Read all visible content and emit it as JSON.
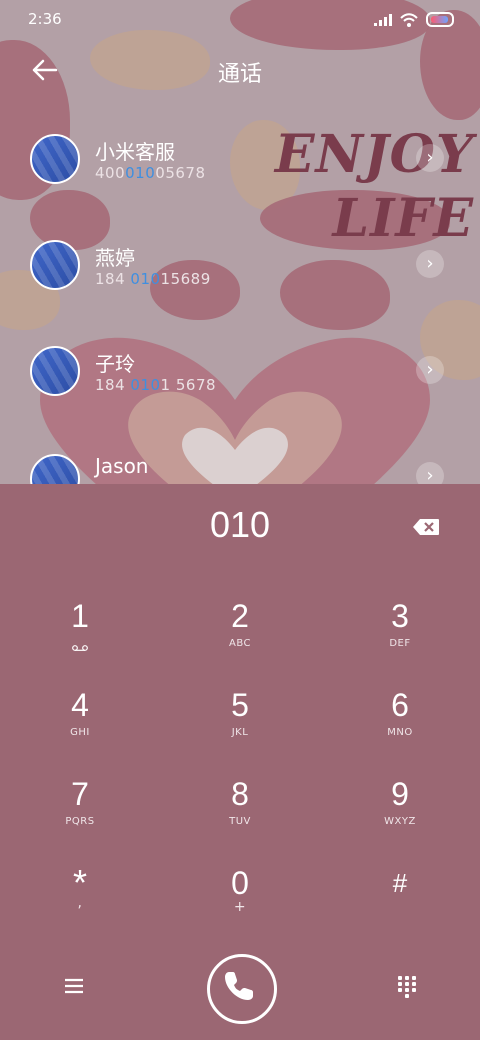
{
  "status_bar": {
    "time": "2:36"
  },
  "header": {
    "title": "通话"
  },
  "wallpaper": {
    "text_line1": "ENJOY",
    "text_line2": "LIFE"
  },
  "contacts": [
    {
      "name": "小米客服",
      "num_pre": "400",
      "num_hl": "010",
      "num_post": "05678"
    },
    {
      "name": "燕婷",
      "num_pre": "184 ",
      "num_hl": "010",
      "num_post": "15689"
    },
    {
      "name": "子玲",
      "num_pre": "184 ",
      "num_hl": "010",
      "num_post": "1 5678"
    },
    {
      "name": "Jason",
      "num_pre": "",
      "num_hl": "",
      "num_post": ""
    }
  ],
  "dialer": {
    "input": "010",
    "keys": [
      {
        "digit": "1",
        "letters": ""
      },
      {
        "digit": "2",
        "letters": "ABC"
      },
      {
        "digit": "3",
        "letters": "DEF"
      },
      {
        "digit": "4",
        "letters": "GHI"
      },
      {
        "digit": "5",
        "letters": "JKL"
      },
      {
        "digit": "6",
        "letters": "MNO"
      },
      {
        "digit": "7",
        "letters": "PQRS"
      },
      {
        "digit": "8",
        "letters": "TUV"
      },
      {
        "digit": "9",
        "letters": "WXYZ"
      },
      {
        "digit": "*",
        "letters": ","
      },
      {
        "digit": "0",
        "letters": "+"
      },
      {
        "digit": "#",
        "letters": ""
      }
    ]
  },
  "colors": {
    "dialer_bg": "#9b6773",
    "highlight": "#3f8fe0"
  }
}
